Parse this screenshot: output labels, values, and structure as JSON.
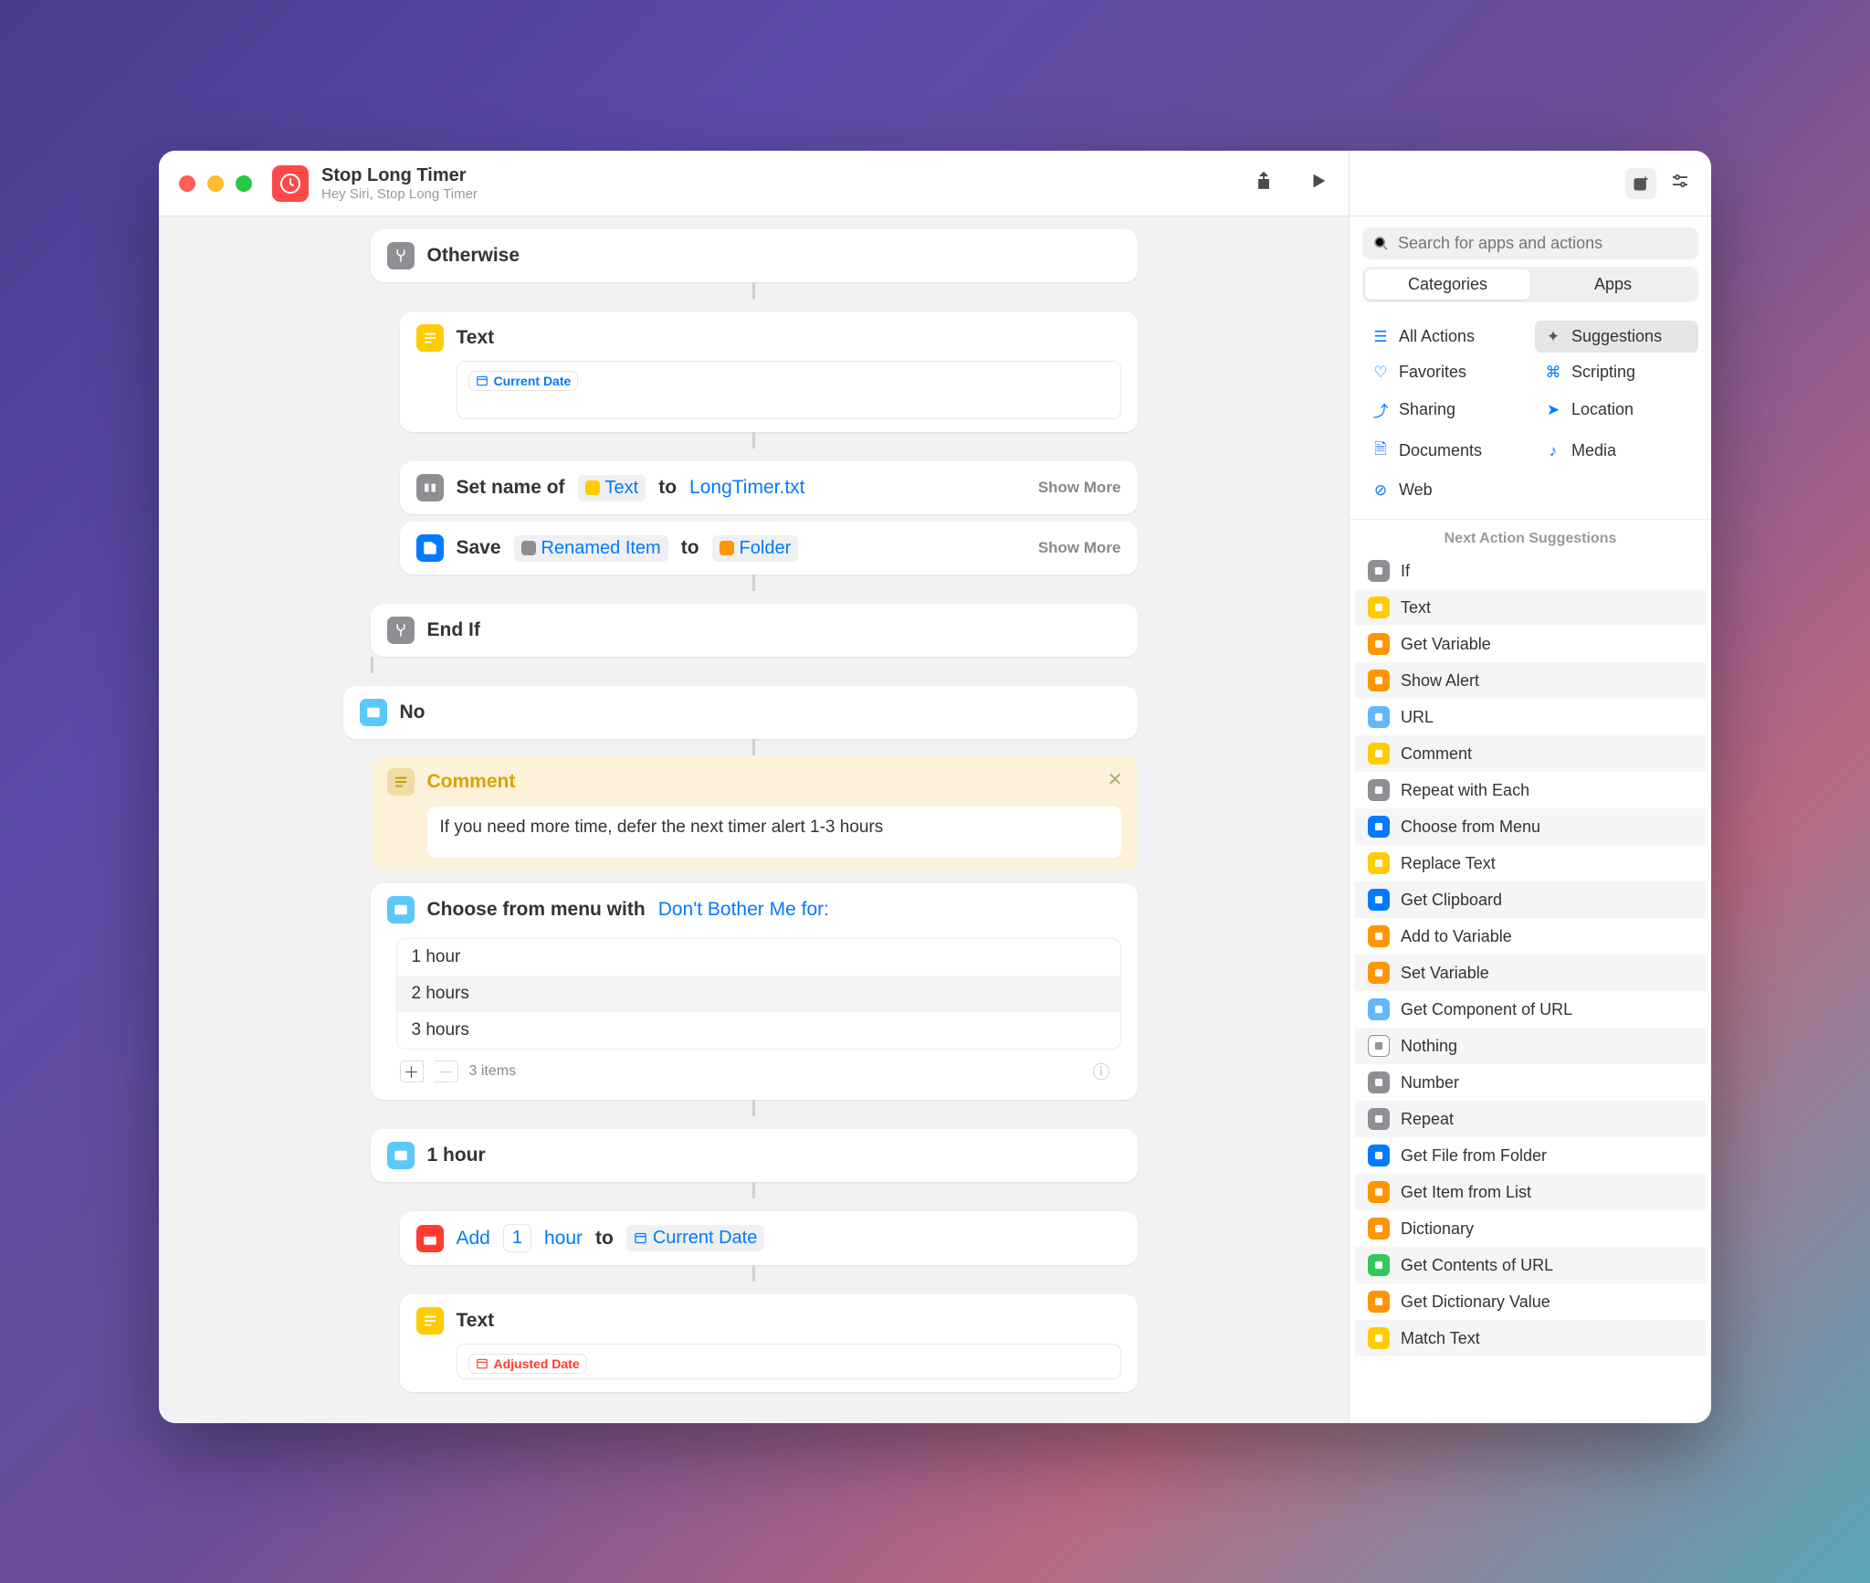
{
  "header": {
    "title": "Stop Long Timer",
    "subtitle": "Hey Siri, Stop Long Timer"
  },
  "actions": {
    "otherwise": "Otherwise",
    "text1": {
      "label": "Text",
      "token": "Current Date"
    },
    "setname": {
      "prefix": "Set name of",
      "var": "Text",
      "to": "to",
      "value": "LongTimer.txt",
      "showmore": "Show More"
    },
    "save": {
      "prefix": "Save",
      "var": "Renamed Item",
      "to": "to",
      "dest": "Folder",
      "showmore": "Show More"
    },
    "endif": "End If",
    "no": "No",
    "comment": {
      "label": "Comment",
      "body": "If you need more time, defer the next timer alert 1-3 hours"
    },
    "menu": {
      "prefix": "Choose from menu with",
      "prompt": "Don't Bother Me for:",
      "options": [
        "1 hour",
        "2 hours",
        "3 hours"
      ],
      "count": "3 items"
    },
    "onehour": "1 hour",
    "add": {
      "verb": "Add",
      "amount": "1",
      "unit": "hour",
      "to": "to",
      "target": "Current Date"
    },
    "text2": {
      "label": "Text",
      "token": "Adjusted Date"
    }
  },
  "sidebar": {
    "search_placeholder": "Search for apps and actions",
    "tabs": {
      "categories": "Categories",
      "apps": "Apps"
    },
    "cats": {
      "all": "All Actions",
      "suggestions": "Suggestions",
      "favorites": "Favorites",
      "scripting": "Scripting",
      "sharing": "Sharing",
      "location": "Location",
      "documents": "Documents",
      "media": "Media",
      "web": "Web"
    },
    "next_header": "Next Action Suggestions",
    "suggestions": [
      "If",
      "Text",
      "Get Variable",
      "Show Alert",
      "URL",
      "Comment",
      "Repeat with Each",
      "Choose from Menu",
      "Replace Text",
      "Get Clipboard",
      "Add to Variable",
      "Set Variable",
      "Get Component of URL",
      "Nothing",
      "Number",
      "Repeat",
      "Get File from Folder",
      "Get Item from List",
      "Dictionary",
      "Get Contents of URL",
      "Get Dictionary Value",
      "Match Text"
    ],
    "suggestion_colors": [
      "grey",
      "yellow",
      "orange",
      "orange",
      "lblue",
      "yellow",
      "grey",
      "blue",
      "yellow",
      "blue",
      "orange",
      "orange",
      "lblue",
      "out",
      "grey",
      "grey",
      "blue",
      "orange",
      "orange",
      "green",
      "orange",
      "yellow"
    ]
  }
}
